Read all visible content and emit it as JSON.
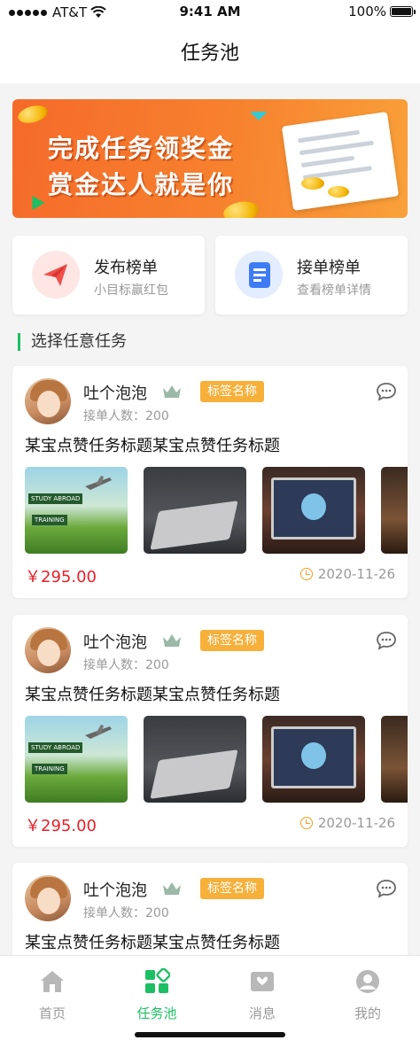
{
  "status_bar": {
    "carrier": "AT&T",
    "time": "9:41 AM",
    "battery": "100%"
  },
  "header": {
    "title": "任务池"
  },
  "banner": {
    "line1": "完成任务领奖金",
    "line2": "赏金达人就是你"
  },
  "quick_actions": [
    {
      "title": "发布榜单",
      "subtitle": "小目标赢红包",
      "icon": "paper-plane-icon",
      "color": "#f0504a"
    },
    {
      "title": "接单榜单",
      "subtitle": "查看榜单详情",
      "icon": "document-icon",
      "color": "#3e7cf5"
    }
  ],
  "section": {
    "title": "选择任意任务"
  },
  "tasks": [
    {
      "user": "吐个泡泡",
      "tag": "标签名称",
      "count": "接单人数：200",
      "title": "某宝点赞任务标题某宝点赞任务标题",
      "price": "￥295.00",
      "date": "2020-11-26"
    },
    {
      "user": "吐个泡泡",
      "tag": "标签名称",
      "count": "接单人数：200",
      "title": "某宝点赞任务标题某宝点赞任务标题",
      "price": "￥295.00",
      "date": "2020-11-26"
    },
    {
      "user": "吐个泡泡",
      "tag": "标签名称",
      "count": "接单人数：200",
      "title": "某宝点赞任务标题某宝点赞任务标题",
      "price": "",
      "date": ""
    }
  ],
  "thumb_texts": {
    "sign1": "STUDY ABROAD",
    "sign2": "TRAINING"
  },
  "tabbar": [
    {
      "label": "首页",
      "icon": "home-icon",
      "active": false
    },
    {
      "label": "任务池",
      "icon": "grid-icon",
      "active": true
    },
    {
      "label": "消息",
      "icon": "message-icon",
      "active": false
    },
    {
      "label": "我的",
      "icon": "user-icon",
      "active": false
    }
  ],
  "colors": {
    "accent": "#1cbf63",
    "price": "#e5202a",
    "tag": "#f7b03a",
    "banner": "#f56a2a"
  }
}
